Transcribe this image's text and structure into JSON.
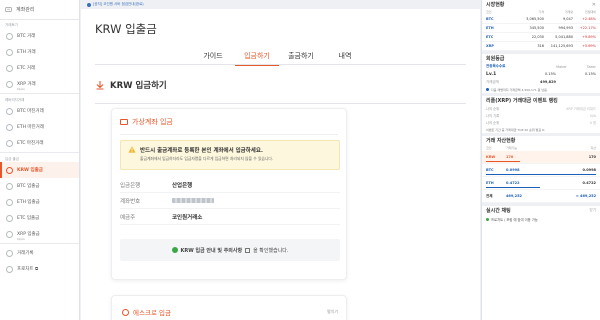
{
  "sidebar": {
    "header": "계좌관리",
    "sections": [
      {
        "label": "거래토기",
        "items": [
          {
            "label": "BTC 거래"
          },
          {
            "label": "ETH 거래"
          },
          {
            "label": "ETC 거래"
          },
          {
            "label": "XRP 거래",
            "sub": "Ripple"
          }
        ]
      },
      {
        "label": "레버리지거래",
        "items": [
          {
            "label": "BTC 마진거래"
          },
          {
            "label": "ETH 마진거래"
          },
          {
            "label": "ETC 마진거래"
          }
        ]
      },
      {
        "label": "입금 출금",
        "items": [
          {
            "label": "KRW 입출금",
            "active": true
          },
          {
            "label": "BTC 입출금"
          },
          {
            "label": "ETH 입출금"
          },
          {
            "label": "ETC 입출금"
          },
          {
            "label": "XRP 입출금",
            "sub": "Ripple"
          }
        ]
      }
    ],
    "bottom_items": [
      {
        "label": "거래기록"
      },
      {
        "label": "프로차트 ⧉"
      }
    ]
  },
  "topbar": {
    "notice": "[공지] 코인원 서버 점검안내(완료)"
  },
  "main": {
    "title": "KRW 입출금",
    "tabs": [
      "가이드",
      "입금하기",
      "출금하기",
      "내역"
    ],
    "active_tab": 1,
    "section_title": "KRW 입금하기",
    "card": {
      "title": "가상계좌 입금",
      "warn_title": "반드시 출금계좌로 등록한 본인 계좌에서 입금하세요.",
      "warn_text": "출금계좌에서 입금하더라도 입금자명을 다르게 입금하면 처리되지 않을 수 있습니다.",
      "rows": [
        {
          "key": "입금은행",
          "value": "산업은행"
        },
        {
          "key": "계좌번호",
          "value": "",
          "blurred": true
        },
        {
          "key": "예금주",
          "value": "코인원거래소"
        }
      ],
      "confirm_text": "KRW 입금 안내 및 주의사항",
      "confirm_suffix": "을 확인했습니다."
    },
    "escrow": {
      "title": "에스크로 입금",
      "expand": "펼치기"
    }
  },
  "right": {
    "market": {
      "title": "시장현황",
      "cols": [
        "코인",
        "가격",
        "거래량",
        "전일대비"
      ],
      "rows": [
        {
          "coin": "BTC",
          "price": "3,065,500",
          "volume": "9,047",
          "change": "+2.48%"
        },
        {
          "coin": "ETH",
          "price": "345,500",
          "volume": "994,993",
          "change": "+22.17%"
        },
        {
          "coin": "ETC",
          "price": "22,030",
          "volume": "5,041,880",
          "change": "+9.89%"
        },
        {
          "coin": "XRP",
          "price": "316",
          "volume": "141,125,693",
          "change": "+5.69%"
        }
      ]
    },
    "fee": {
      "title": "회원등급",
      "tabs": [
        "전종목수수료",
        "Maker",
        "Taker"
      ],
      "level": "Lv.1",
      "maker": "0.15%",
      "taker": "0.15%",
      "volume_label": "거래금액",
      "volume_value": "499,829",
      "note": "다음 레벨까지 거래금액 4,500,171 원 남음"
    },
    "event": {
      "title": "리플(XRP) 거래대금 이벤트 랭킹",
      "rows": [
        {
          "label": "나의 순위",
          "value": "XRP 거래대금 리워드"
        },
        {
          "label": "나의 기록",
          "value": "N/A"
        },
        {
          "label": "나의 순위",
          "value": "0 원"
        }
      ],
      "footnote": "이벤트 기간 중 거래대금 TOP 20 순위 발표 ⧉"
    },
    "assets": {
      "title": "거래 자산현황",
      "cols": [
        "코인",
        "거래가능",
        "자산"
      ],
      "rows": [
        {
          "coin": "KRW",
          "avail": "170",
          "total": "170",
          "krw": true
        },
        {
          "coin": "BTC",
          "avail": "0.0998",
          "total": "0.0998"
        },
        {
          "coin": "ETH",
          "avail": "0.4722",
          "total": "0.4722"
        },
        {
          "coin": "전체",
          "avail": "469,252",
          "total": "≈ 469,252",
          "total_row": true
        }
      ]
    },
    "chat": {
      "title": "실시간 채팅",
      "text": "프로차트 / 포럼 에 참여 이용 가능",
      "toggle": "닫기"
    },
    "colors": {
      "accent": "#e8572a",
      "blue": "#1d5fb6",
      "up": "#d32f2f"
    }
  }
}
